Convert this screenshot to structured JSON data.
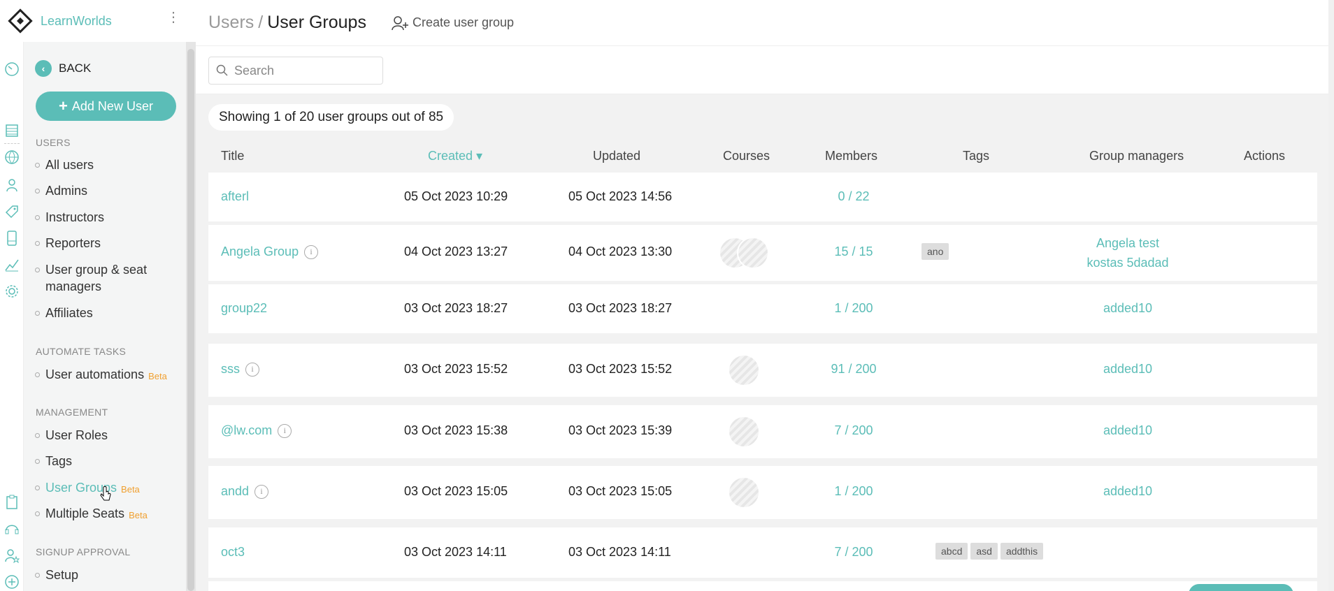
{
  "brand": {
    "name": "LearnWorlds"
  },
  "sidebar": {
    "back_label": "BACK",
    "add_user_label": "Add New User",
    "sections": {
      "users": "USERS",
      "automate": "AUTOMATE TASKS",
      "management": "MANAGEMENT",
      "signup": "SIGNUP APPROVAL"
    },
    "users_items": [
      {
        "label": "All users"
      },
      {
        "label": "Admins"
      },
      {
        "label": "Instructors"
      },
      {
        "label": "Reporters"
      },
      {
        "label": "User group & seat managers"
      },
      {
        "label": "Affiliates"
      }
    ],
    "automate_items": [
      {
        "label": "User automations",
        "badge": "Beta"
      }
    ],
    "management_items": [
      {
        "label": "User Roles"
      },
      {
        "label": "Tags"
      },
      {
        "label": "User Groups",
        "badge": "Beta",
        "active": true
      },
      {
        "label": "Multiple Seats",
        "badge": "Beta"
      }
    ],
    "signup_items": [
      {
        "label": "Setup"
      }
    ]
  },
  "header": {
    "breadcrumb_parent": "Users",
    "breadcrumb_sep": "/",
    "breadcrumb_current": "User Groups",
    "create_label": "Create user group"
  },
  "search": {
    "placeholder": "Search"
  },
  "summary": "Showing 1 of 20 user groups out of 85",
  "table": {
    "columns": {
      "title": "Title",
      "created": "Created ▾",
      "updated": "Updated",
      "courses": "Courses",
      "members": "Members",
      "tags": "Tags",
      "managers": "Group managers",
      "actions": "Actions"
    },
    "rows": [
      {
        "title": "afterl",
        "info": false,
        "created": "05 Oct 2023 10:29",
        "updated": "05 Oct 2023 14:56",
        "courses": 0,
        "members": "0 / 22",
        "tags": [],
        "managers": []
      },
      {
        "title": "Angela Group",
        "info": true,
        "created": "04 Oct 2023 13:27",
        "updated": "04 Oct 2023 13:30",
        "courses": 2,
        "members": "15 / 15",
        "tags": [
          "ano"
        ],
        "managers": [
          "Angela test",
          "kostas 5dadad"
        ]
      },
      {
        "title": "group22",
        "info": false,
        "created": "03 Oct 2023 18:27",
        "updated": "03 Oct 2023 18:27",
        "courses": 0,
        "members": "1 / 200",
        "tags": [],
        "managers": [
          "added10"
        ]
      },
      {
        "title": "sss",
        "info": true,
        "created": "03 Oct 2023 15:52",
        "updated": "03 Oct 2023 15:52",
        "courses": 1,
        "members": "91 / 200",
        "tags": [],
        "managers": [
          "added10"
        ]
      },
      {
        "title": "@lw.com",
        "info": true,
        "created": "03 Oct 2023 15:38",
        "updated": "03 Oct 2023 15:39",
        "courses": 1,
        "members": "7 / 200",
        "tags": [],
        "managers": [
          "added10"
        ]
      },
      {
        "title": "andd",
        "info": true,
        "created": "03 Oct 2023 15:05",
        "updated": "03 Oct 2023 15:05",
        "courses": 1,
        "members": "1 / 200",
        "tags": [],
        "managers": [
          "added10"
        ]
      },
      {
        "title": "oct3",
        "info": false,
        "created": "03 Oct 2023 14:11",
        "updated": "03 Oct 2023 14:11",
        "courses": 0,
        "members": "7 / 200",
        "tags": [
          "abcd",
          "asd",
          "addthis"
        ],
        "managers": []
      }
    ]
  }
}
